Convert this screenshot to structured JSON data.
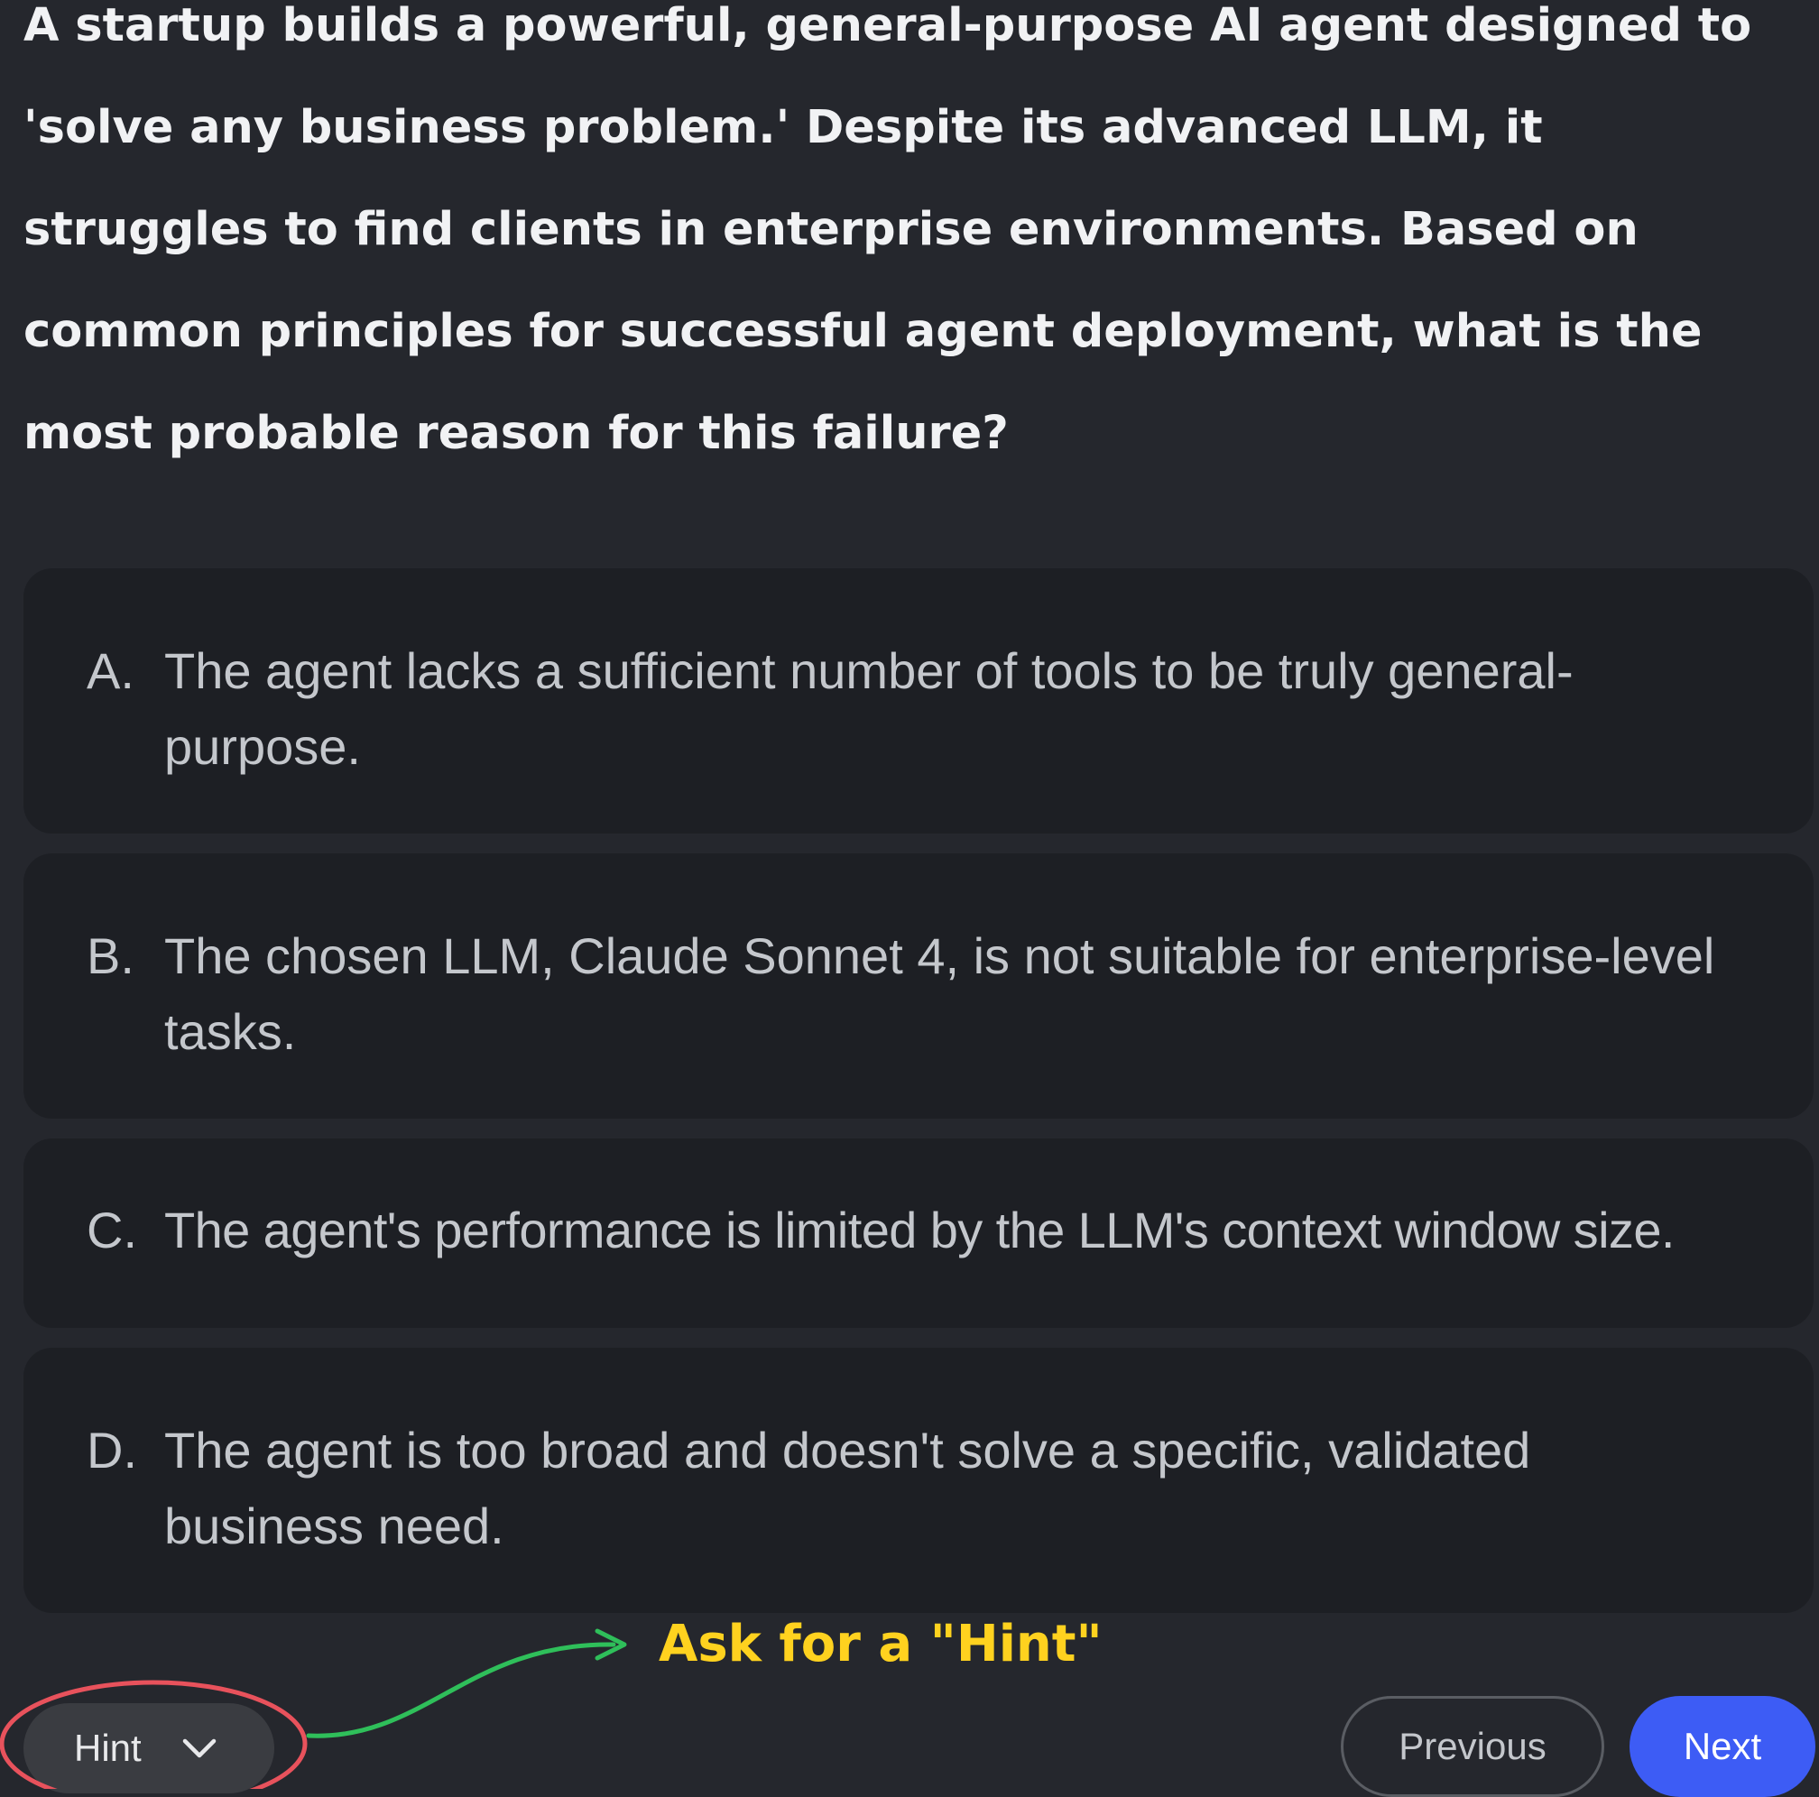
{
  "question": {
    "text": "A startup builds a powerful, general-purpose AI agent designed to 'solve any business problem.' Despite its advanced LLM, it struggles to find clients in enterprise environments. Based on common principles for successful agent deployment, what is the most probable reason for this failure?"
  },
  "options": [
    {
      "letter": "A.",
      "text": "The agent lacks a sufficient number of tools to be truly general-purpose."
    },
    {
      "letter": "B.",
      "text": "The chosen LLM, Claude Sonnet 4, is not suitable for enterprise-level tasks."
    },
    {
      "letter": "C.",
      "text": "The agent's performance is limited by the LLM's context window size."
    },
    {
      "letter": "D.",
      "text": "The agent is too broad and doesn't solve a specific, validated business need."
    }
  ],
  "controls": {
    "hint_label": "Hint",
    "hint_icon": "chevron-down-icon",
    "previous_label": "Previous",
    "next_label": "Next"
  },
  "annotation": {
    "text": "Ask for a \"Hint\"",
    "text_color": "#ffd21f",
    "arrow_color": "#2fbf5a",
    "circle_color": "#e8525c"
  },
  "colors": {
    "background": "#25272d",
    "option_background": "#1d1f24",
    "accent": "#3d5cf5"
  }
}
